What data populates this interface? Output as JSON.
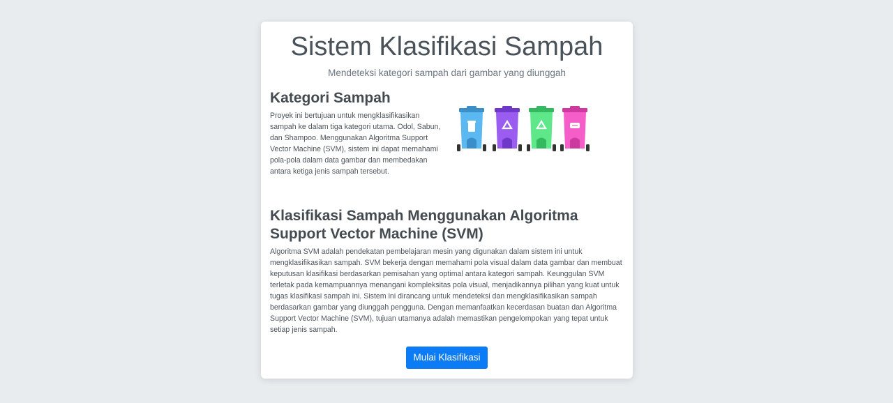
{
  "header": {
    "title": "Sistem Klasifikasi Sampah",
    "subtitle": "Mendeteksi kategori sampah dari gambar yang diunggah"
  },
  "categories_section": {
    "heading": "Kategori Sampah",
    "body": "Proyek ini bertujuan untuk mengklasifikasikan sampah ke dalam tiga kategori utama. Odol, Sabun, dan Shampoo. Menggunakan Algoritma Support Vector Machine (SVM), sistem ini dapat memahami pola-pola dalam data gambar dan membedakan antara ketiga jenis sampah tersebut."
  },
  "svm_section": {
    "heading": "Klasifikasi Sampah Menggunakan Algoritma Support Vector Machine (SVM)",
    "body": "Algoritma SVM adalah pendekatan pembelajaran mesin yang digunakan dalam sistem ini untuk mengklasifikasikan sampah. SVM bekerja dengan memahami pola visual dalam data gambar dan membuat keputusan klasifikasi berdasarkan pemisahan yang optimal antara kategori sampah. Keunggulan SVM terletak pada kemampuannya menangani kompleksitas pola visual, menjadikannya pilihan yang kuat untuk tugas klasifikasi sampah ini. Sistem ini dirancang untuk mendeteksi dan mengklasifikasikan sampah berdasarkan gambar yang diunggah pengguna. Dengan memanfaatkan kecerdasan buatan dan Algoritma Support Vector Machine (SVM), tujuan utamanya adalah memastikan pengelompokan yang tepat untuk setiap jenis sampah."
  },
  "illustration": {
    "bins": [
      {
        "icon": "cup-icon",
        "color": "#5bb8f0",
        "dark": "#3a8fc8"
      },
      {
        "icon": "recycle-icon",
        "color": "#9b5cf0",
        "dark": "#7038c8"
      },
      {
        "icon": "recycle-icon",
        "color": "#5fe88a",
        "dark": "#34b860"
      },
      {
        "icon": "battery-icon",
        "color": "#f55ec8",
        "dark": "#cc3aa0"
      }
    ]
  },
  "actions": {
    "start_label": "Mulai Klasifikasi"
  },
  "colors": {
    "background": "#e8ecef",
    "card": "#ffffff",
    "button": "#0b7bf6",
    "heading": "#434a50"
  }
}
